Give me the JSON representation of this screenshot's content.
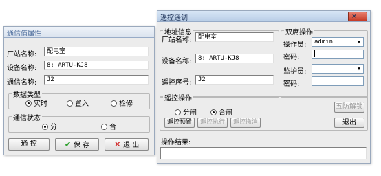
{
  "left_dialog": {
    "title": "通信值属性",
    "station_label": "厂站名称:",
    "station_value": "配电室",
    "device_label": "设备名称:",
    "device_value": "8: ARTU-KJ8",
    "comm_label": "通信名称:",
    "comm_value": "J2",
    "data_type_group": "数据类型",
    "data_type_options": [
      "实时",
      "置入",
      "检修"
    ],
    "comm_status_group": "通信状态",
    "comm_status_options": [
      "分",
      "合"
    ],
    "btn_control": "通 控",
    "btn_save": "保 存",
    "btn_exit": "退 出",
    "save_icon": "checkmark-icon",
    "exit_icon": "x-icon"
  },
  "right_dialog": {
    "title": "遥控遥调",
    "close_glyph": "✕",
    "address_group": "地址信息",
    "station_label": "厂站名称:",
    "station_value": "配电室",
    "device_label": "设备名称:",
    "device_value": "8: ARTU-KJ8",
    "seq_label": "遥控序号:",
    "seq_value": "J2",
    "dual_group": "双席操作",
    "operator_label": "操作员:",
    "operator_value": "admin",
    "password_label": "密码:",
    "guardian_label": "监护员:",
    "guardian_value": "",
    "password2_label": "密码:",
    "control_group": "遥控操作",
    "control_options": [
      "分闸",
      "合闸"
    ],
    "btn_unlock": "五防解锁",
    "btn_preset": "遥控预置",
    "btn_execute": "遥控执行",
    "btn_cancel": "遥控撤消",
    "btn_exit": "退出",
    "result_label": "操作结果:",
    "result_value": ""
  }
}
